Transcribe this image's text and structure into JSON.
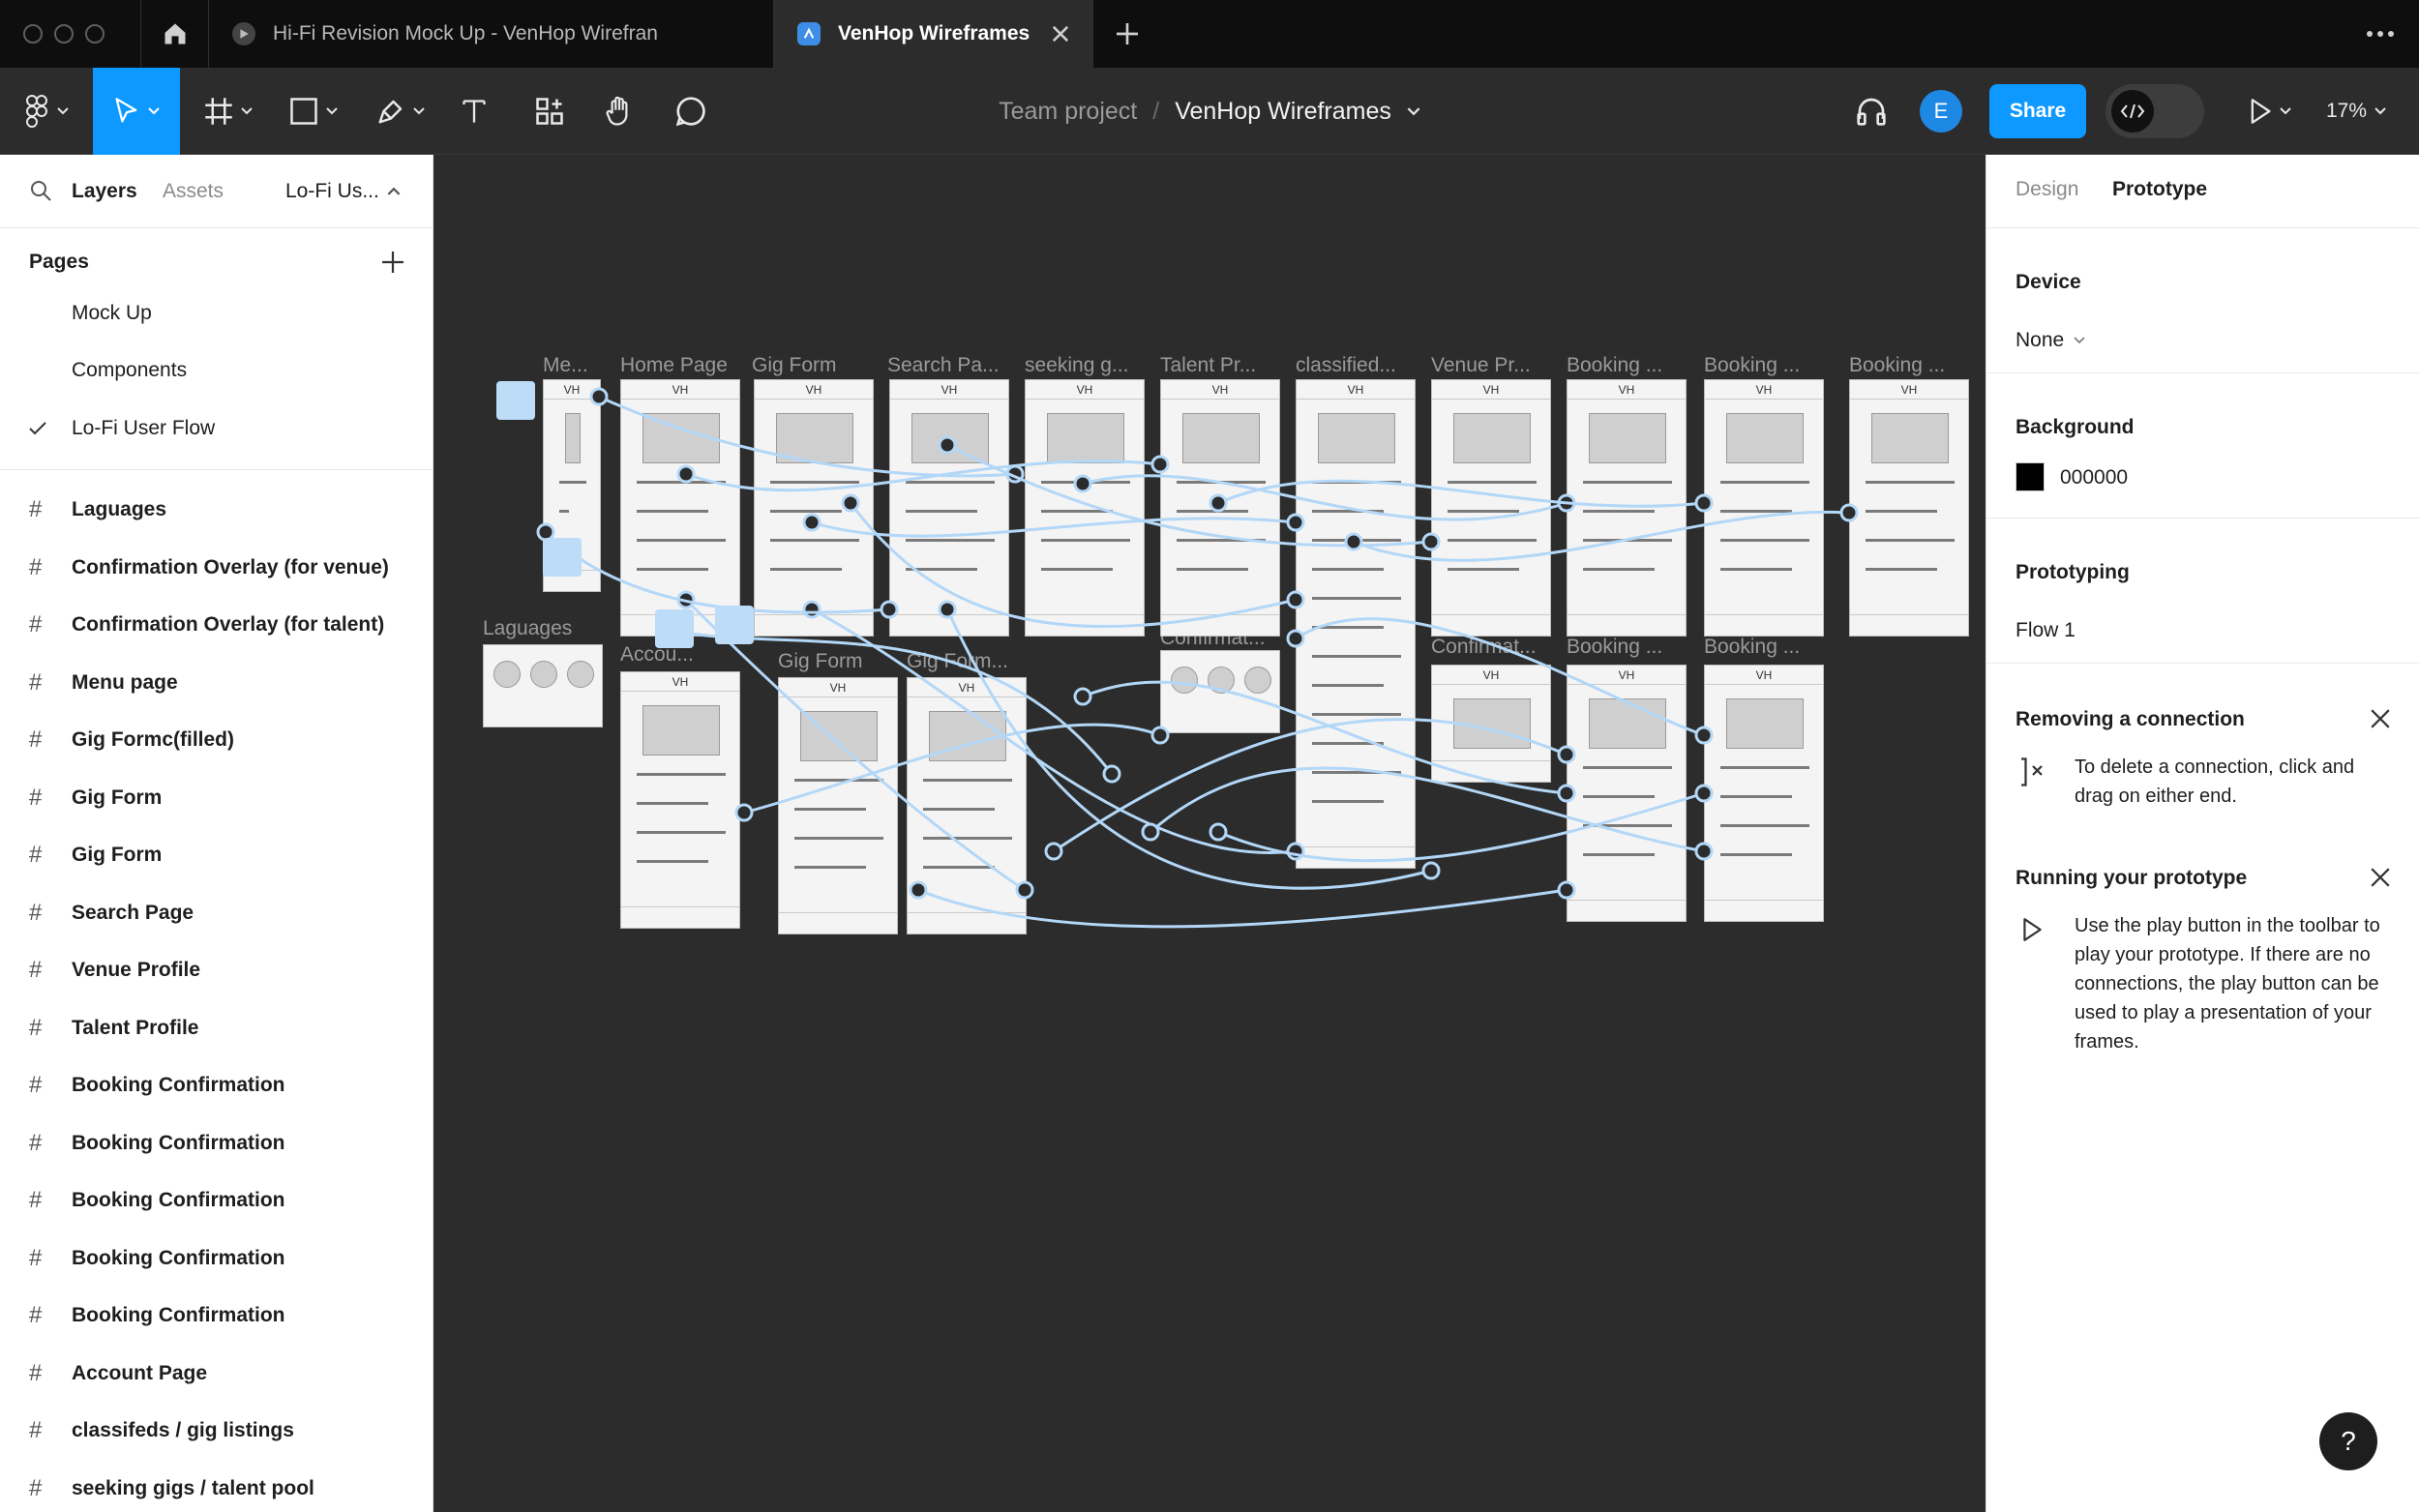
{
  "tabs": {
    "tab1_title": "Hi-Fi Revision Mock Up - VenHop Wirefran",
    "tab2_title": "VenHop Wireframes"
  },
  "toolbar": {
    "team": "Team project",
    "separator": "/",
    "file_name": "VenHop Wireframes",
    "avatar_letter": "E",
    "share_label": "Share",
    "zoom": "17%",
    "tools": [
      "main-menu-icon",
      "move-icon",
      "frame-icon",
      "rectangle-icon",
      "pen-icon",
      "text-icon",
      "components-icon",
      "hand-icon",
      "comment-icon"
    ]
  },
  "left_panel": {
    "layers_tab": "Layers",
    "assets_tab": "Assets",
    "page_selector": "Lo-Fi Us...",
    "pages_heading": "Pages",
    "pages": [
      "Mock Up",
      "Components",
      "Lo-Fi User Flow"
    ],
    "current_page": "Lo-Fi User Flow",
    "layers": [
      "Laguages",
      "Confirmation Overlay (for venue)",
      "Confirmation Overlay (for talent)",
      "Menu page",
      "Gig Formc(filled)",
      "Gig Form",
      "Gig Form",
      "Search Page",
      "Venue Profile",
      "Talent Profile",
      "Booking Confirmation",
      "Booking Confirmation",
      "Booking Confirmation",
      "Booking Confirmation",
      "Booking Confirmation",
      "Account Page",
      "classifeds / gig listings",
      "seeking gigs / talent pool"
    ]
  },
  "canvas": {
    "frame_labels": [
      "Me...",
      "Home Page",
      "Gig Form",
      "Search Pa...",
      "seeking g...",
      "Talent Pr...",
      "classified...",
      "Venue Pr...",
      "Booking ...",
      "Booking ...",
      "Booking ...",
      "Laguages",
      "Accou...",
      "Gig Form",
      "Gig Form...",
      "Confirmat...",
      "Confirmat...",
      "Booking ...",
      "Booking ..."
    ],
    "frame_header": "VH",
    "connector_color": "#b3d7f7"
  },
  "right_panel": {
    "design_tab": "Design",
    "prototype_tab": "Prototype",
    "device_title": "Device",
    "device_value": "None",
    "background_title": "Background",
    "background_value": "000000",
    "background_color": "#000000",
    "prototyping_title": "Prototyping",
    "flow_name": "Flow 1",
    "tip1_title": "Removing a connection",
    "tip1_text": "To delete a connection, click and drag on either end.",
    "tip2_title": "Running your prototype",
    "tip2_text": "Use the play button in the toolbar to play your prototype. If there are no connections, the play button can be used to play a presentation of your frames.",
    "help": "?"
  }
}
